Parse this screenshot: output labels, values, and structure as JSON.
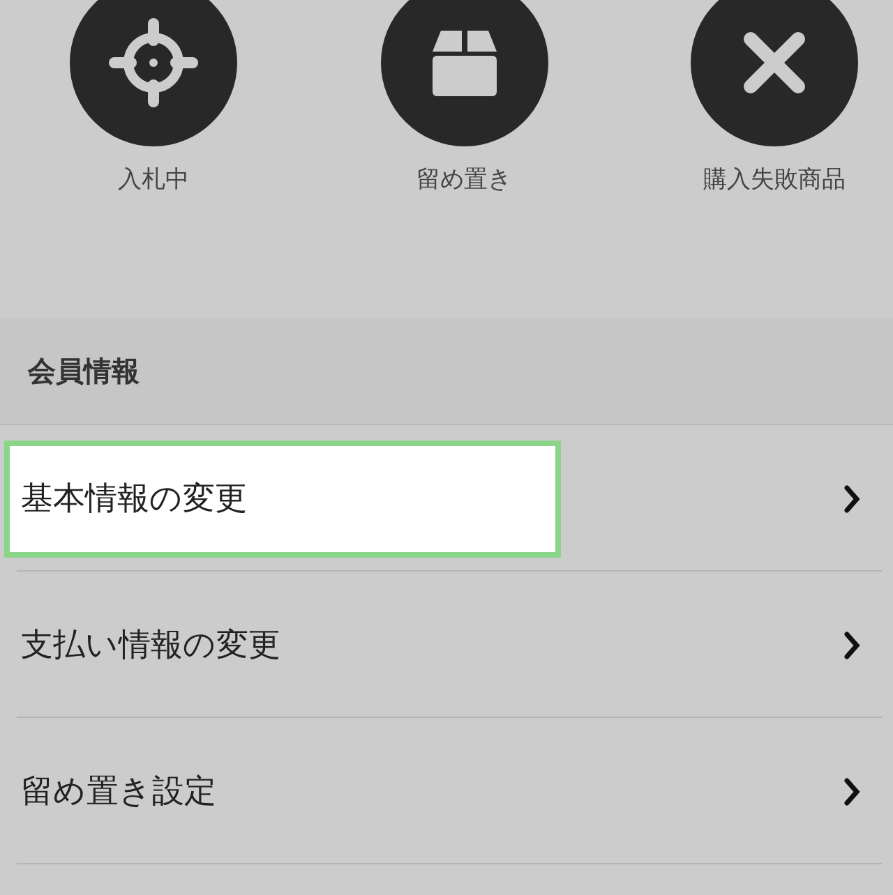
{
  "shortcuts": [
    {
      "kind": "target",
      "label": "入札中"
    },
    {
      "kind": "box",
      "label": "留め置き"
    },
    {
      "kind": "cross",
      "label": "購入失敗商品"
    }
  ],
  "section": {
    "title": "会員情報",
    "items": [
      {
        "label": "基本情報の変更",
        "highlighted": true
      },
      {
        "label": "支払い情報の変更",
        "highlighted": false
      },
      {
        "label": "留め置き設定",
        "highlighted": false
      }
    ]
  }
}
